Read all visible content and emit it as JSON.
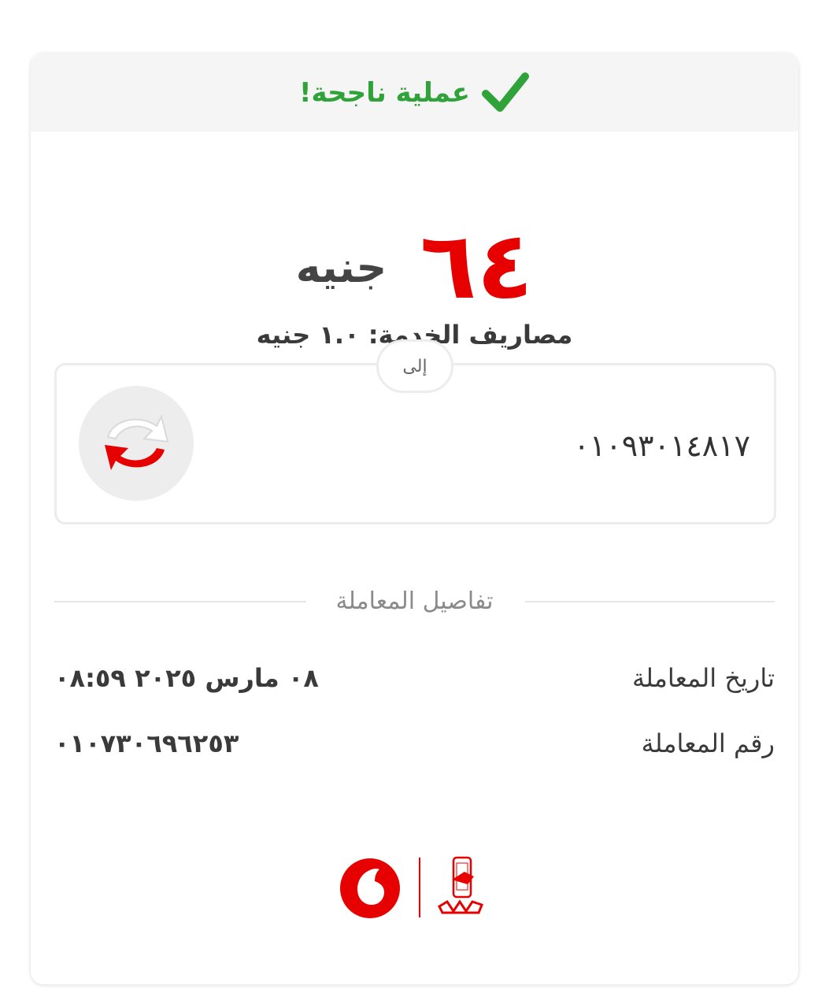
{
  "status": {
    "text": "عملية ناجحة!",
    "icon": "check-icon",
    "color": "#2fa33a"
  },
  "amount": {
    "value": "٦٤",
    "currency": "جنيه",
    "value_color": "#e60000"
  },
  "fees": {
    "text": "مصاريف الخدمة: ١.٠ جنيه"
  },
  "recipient": {
    "to_label": "إلى",
    "phone": "٠١٠٩٣٠١٤٨١٧",
    "icon": "transfer-arrows-icon"
  },
  "details": {
    "section_title": "تفاصيل المعاملة",
    "rows": [
      {
        "label": "تاريخ المعاملة",
        "value": "٠٨ مارس ٢٠٢٥ ٠٨:٥٩"
      },
      {
        "label": "رقم المعاملة",
        "value": "٠١٠٧٣٠٦٩٦٢٥٣"
      }
    ]
  },
  "footer": {
    "logos": [
      "vodafone-logo",
      "vodafone-cash-logo"
    ],
    "brand_color": "#e60000"
  }
}
